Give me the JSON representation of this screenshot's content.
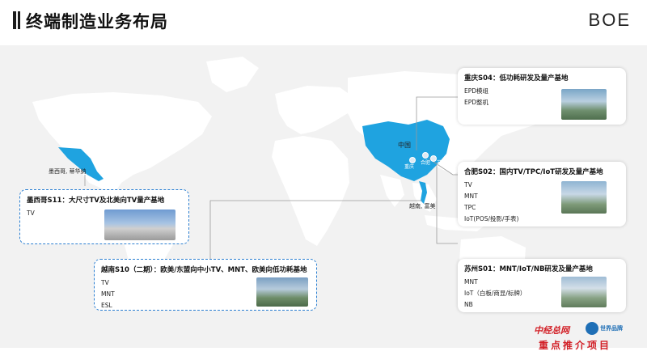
{
  "title": "终端制造业务布局",
  "logo": "BOE",
  "map_labels": {
    "china": "中国",
    "mexico": "墨西哥, 蒂华纳",
    "vietnam": "越南, 富美",
    "chongqing": "重庆",
    "hefei": "合肥",
    "suzhou": "苏州"
  },
  "callouts": {
    "chongqing": {
      "title": "重庆S04：低功耗研发及量产基地",
      "lines": [
        "EPD模组",
        "EPD整机"
      ]
    },
    "hefei": {
      "title": "合肥S02：国内TV/TPC/IoT研发及量产基地",
      "lines": [
        "TV",
        "MNT",
        "TPC",
        "IoT(POS/投影/手表)"
      ]
    },
    "suzhou": {
      "title": "苏州S01：MNT/IoT/NB研发及量产基地",
      "lines": [
        "MNT",
        "IoT（白板/商显/标牌）",
        "NB"
      ]
    },
    "mexico": {
      "title": "墨西哥S11：大尺寸TV及北美向TV量产基地",
      "lines": [
        "TV"
      ]
    },
    "vietnam": {
      "title": "越南S10（二期）：欧美/东盟向中小TV、MNT、欧美向低功耗基地",
      "lines": [
        "TV",
        "MNT",
        "ESL"
      ]
    }
  },
  "footer": {
    "brand_left": "中经总网",
    "brand_right": "世界品牌",
    "tagline": "重点推介项目"
  },
  "colors": {
    "highlight": "#1fa3e0",
    "land": "#ffffff",
    "ocean": "#f2f2f2",
    "accent": "#2b7fd1",
    "red": "#d21f26"
  }
}
